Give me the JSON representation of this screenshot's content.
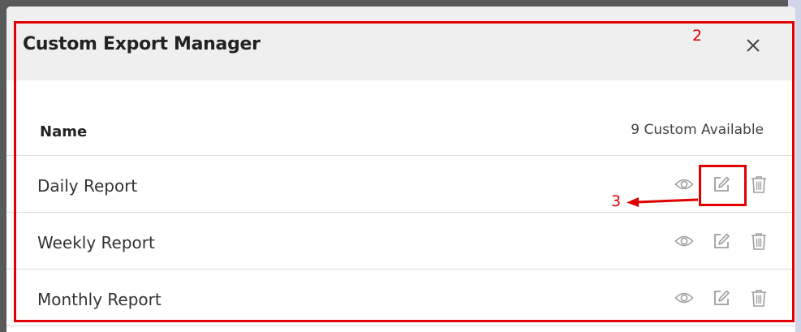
{
  "dialog": {
    "title": "Custom Export Manager",
    "close_icon": "close-icon"
  },
  "table": {
    "column_name": "Name",
    "count_text": "9 Custom Available",
    "rows": [
      {
        "label": "Daily Report"
      },
      {
        "label": "Weekly Report"
      },
      {
        "label": "Monthly Report"
      }
    ],
    "row_action_icons": [
      "eye-icon",
      "edit-icon",
      "trash-icon"
    ]
  },
  "annotations": {
    "label_outer": "2",
    "label_edit": "3",
    "color": "#e00000"
  },
  "colors": {
    "header_bg": "#efefef",
    "icon": "#9e9e9e",
    "text": "#333333"
  }
}
